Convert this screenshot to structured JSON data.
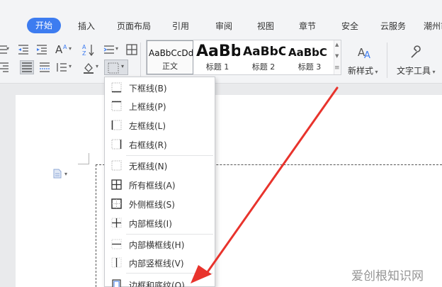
{
  "menu": {
    "tabs": [
      {
        "label": "开始",
        "active": true
      },
      {
        "label": "插入"
      },
      {
        "label": "页面布局"
      },
      {
        "label": "引用"
      },
      {
        "label": "审阅"
      },
      {
        "label": "视图"
      },
      {
        "label": "章节"
      },
      {
        "label": "安全"
      },
      {
        "label": "云服务"
      },
      {
        "label": "潮州市"
      }
    ]
  },
  "ribbon": {
    "styles": [
      {
        "preview": "AaBbCcDd",
        "label": "正文",
        "selected": true
      },
      {
        "preview": "AaBb",
        "label": "标题 1"
      },
      {
        "preview": "AaBbC",
        "label": "标题 2"
      },
      {
        "preview": "AaBbC",
        "label": "标题 3"
      }
    ],
    "new_style_label": "新样式",
    "text_tools_label": "文字工具"
  },
  "dropdown": {
    "items": [
      {
        "label": "下框线(B)",
        "icon": "bottom-border-icon"
      },
      {
        "label": "上框线(P)",
        "icon": "top-border-icon"
      },
      {
        "label": "左框线(L)",
        "icon": "left-border-icon"
      },
      {
        "label": "右框线(R)",
        "icon": "right-border-icon"
      },
      {
        "label": "无框线(N)",
        "icon": "no-border-icon"
      },
      {
        "label": "所有框线(A)",
        "icon": "all-borders-icon"
      },
      {
        "label": "外侧框线(S)",
        "icon": "outside-borders-icon"
      },
      {
        "label": "内部框线(I)",
        "icon": "inside-borders-icon"
      },
      {
        "label": "内部横框线(H)",
        "icon": "inside-horizontal-border-icon"
      },
      {
        "label": "内部竖框线(V)",
        "icon": "inside-vertical-border-icon"
      },
      {
        "label": "边框和底纹(O)...",
        "icon": "borders-and-shading-icon"
      }
    ]
  },
  "watermark": "爱创根知识网",
  "colors": {
    "accent": "#3d7cf0",
    "arrow": "#e8332c"
  }
}
